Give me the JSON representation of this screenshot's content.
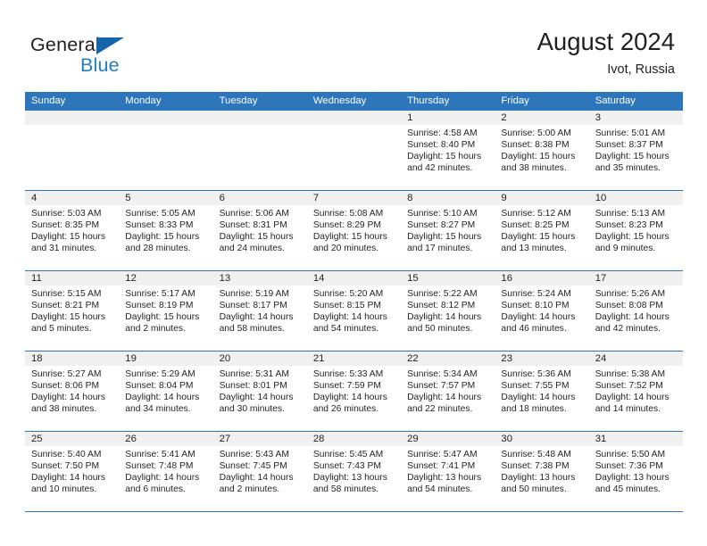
{
  "brand": {
    "name_part1": "General",
    "name_part2": "Blue",
    "accent_color": "#1f7fc4",
    "triangle_color": "#1565a8"
  },
  "header": {
    "title": "August 2024",
    "subtitle": "Ivot, Russia"
  },
  "calendar": {
    "header_bg": "#2e76bc",
    "daynum_band_bg": "#f0f0f0",
    "weekdays": [
      "Sunday",
      "Monday",
      "Tuesday",
      "Wednesday",
      "Thursday",
      "Friday",
      "Saturday"
    ],
    "weeks": [
      [
        {
          "day": "",
          "lines": []
        },
        {
          "day": "",
          "lines": []
        },
        {
          "day": "",
          "lines": []
        },
        {
          "day": "",
          "lines": []
        },
        {
          "day": "1",
          "lines": [
            "Sunrise: 4:58 AM",
            "Sunset: 8:40 PM",
            "Daylight: 15 hours",
            "and 42 minutes."
          ]
        },
        {
          "day": "2",
          "lines": [
            "Sunrise: 5:00 AM",
            "Sunset: 8:38 PM",
            "Daylight: 15 hours",
            "and 38 minutes."
          ]
        },
        {
          "day": "3",
          "lines": [
            "Sunrise: 5:01 AM",
            "Sunset: 8:37 PM",
            "Daylight: 15 hours",
            "and 35 minutes."
          ]
        }
      ],
      [
        {
          "day": "4",
          "lines": [
            "Sunrise: 5:03 AM",
            "Sunset: 8:35 PM",
            "Daylight: 15 hours",
            "and 31 minutes."
          ]
        },
        {
          "day": "5",
          "lines": [
            "Sunrise: 5:05 AM",
            "Sunset: 8:33 PM",
            "Daylight: 15 hours",
            "and 28 minutes."
          ]
        },
        {
          "day": "6",
          "lines": [
            "Sunrise: 5:06 AM",
            "Sunset: 8:31 PM",
            "Daylight: 15 hours",
            "and 24 minutes."
          ]
        },
        {
          "day": "7",
          "lines": [
            "Sunrise: 5:08 AM",
            "Sunset: 8:29 PM",
            "Daylight: 15 hours",
            "and 20 minutes."
          ]
        },
        {
          "day": "8",
          "lines": [
            "Sunrise: 5:10 AM",
            "Sunset: 8:27 PM",
            "Daylight: 15 hours",
            "and 17 minutes."
          ]
        },
        {
          "day": "9",
          "lines": [
            "Sunrise: 5:12 AM",
            "Sunset: 8:25 PM",
            "Daylight: 15 hours",
            "and 13 minutes."
          ]
        },
        {
          "day": "10",
          "lines": [
            "Sunrise: 5:13 AM",
            "Sunset: 8:23 PM",
            "Daylight: 15 hours",
            "and 9 minutes."
          ]
        }
      ],
      [
        {
          "day": "11",
          "lines": [
            "Sunrise: 5:15 AM",
            "Sunset: 8:21 PM",
            "Daylight: 15 hours",
            "and 5 minutes."
          ]
        },
        {
          "day": "12",
          "lines": [
            "Sunrise: 5:17 AM",
            "Sunset: 8:19 PM",
            "Daylight: 15 hours",
            "and 2 minutes."
          ]
        },
        {
          "day": "13",
          "lines": [
            "Sunrise: 5:19 AM",
            "Sunset: 8:17 PM",
            "Daylight: 14 hours",
            "and 58 minutes."
          ]
        },
        {
          "day": "14",
          "lines": [
            "Sunrise: 5:20 AM",
            "Sunset: 8:15 PM",
            "Daylight: 14 hours",
            "and 54 minutes."
          ]
        },
        {
          "day": "15",
          "lines": [
            "Sunrise: 5:22 AM",
            "Sunset: 8:12 PM",
            "Daylight: 14 hours",
            "and 50 minutes."
          ]
        },
        {
          "day": "16",
          "lines": [
            "Sunrise: 5:24 AM",
            "Sunset: 8:10 PM",
            "Daylight: 14 hours",
            "and 46 minutes."
          ]
        },
        {
          "day": "17",
          "lines": [
            "Sunrise: 5:26 AM",
            "Sunset: 8:08 PM",
            "Daylight: 14 hours",
            "and 42 minutes."
          ]
        }
      ],
      [
        {
          "day": "18",
          "lines": [
            "Sunrise: 5:27 AM",
            "Sunset: 8:06 PM",
            "Daylight: 14 hours",
            "and 38 minutes."
          ]
        },
        {
          "day": "19",
          "lines": [
            "Sunrise: 5:29 AM",
            "Sunset: 8:04 PM",
            "Daylight: 14 hours",
            "and 34 minutes."
          ]
        },
        {
          "day": "20",
          "lines": [
            "Sunrise: 5:31 AM",
            "Sunset: 8:01 PM",
            "Daylight: 14 hours",
            "and 30 minutes."
          ]
        },
        {
          "day": "21",
          "lines": [
            "Sunrise: 5:33 AM",
            "Sunset: 7:59 PM",
            "Daylight: 14 hours",
            "and 26 minutes."
          ]
        },
        {
          "day": "22",
          "lines": [
            "Sunrise: 5:34 AM",
            "Sunset: 7:57 PM",
            "Daylight: 14 hours",
            "and 22 minutes."
          ]
        },
        {
          "day": "23",
          "lines": [
            "Sunrise: 5:36 AM",
            "Sunset: 7:55 PM",
            "Daylight: 14 hours",
            "and 18 minutes."
          ]
        },
        {
          "day": "24",
          "lines": [
            "Sunrise: 5:38 AM",
            "Sunset: 7:52 PM",
            "Daylight: 14 hours",
            "and 14 minutes."
          ]
        }
      ],
      [
        {
          "day": "25",
          "lines": [
            "Sunrise: 5:40 AM",
            "Sunset: 7:50 PM",
            "Daylight: 14 hours",
            "and 10 minutes."
          ]
        },
        {
          "day": "26",
          "lines": [
            "Sunrise: 5:41 AM",
            "Sunset: 7:48 PM",
            "Daylight: 14 hours",
            "and 6 minutes."
          ]
        },
        {
          "day": "27",
          "lines": [
            "Sunrise: 5:43 AM",
            "Sunset: 7:45 PM",
            "Daylight: 14 hours",
            "and 2 minutes."
          ]
        },
        {
          "day": "28",
          "lines": [
            "Sunrise: 5:45 AM",
            "Sunset: 7:43 PM",
            "Daylight: 13 hours",
            "and 58 minutes."
          ]
        },
        {
          "day": "29",
          "lines": [
            "Sunrise: 5:47 AM",
            "Sunset: 7:41 PM",
            "Daylight: 13 hours",
            "and 54 minutes."
          ]
        },
        {
          "day": "30",
          "lines": [
            "Sunrise: 5:48 AM",
            "Sunset: 7:38 PM",
            "Daylight: 13 hours",
            "and 50 minutes."
          ]
        },
        {
          "day": "31",
          "lines": [
            "Sunrise: 5:50 AM",
            "Sunset: 7:36 PM",
            "Daylight: 13 hours",
            "and 45 minutes."
          ]
        }
      ]
    ]
  }
}
